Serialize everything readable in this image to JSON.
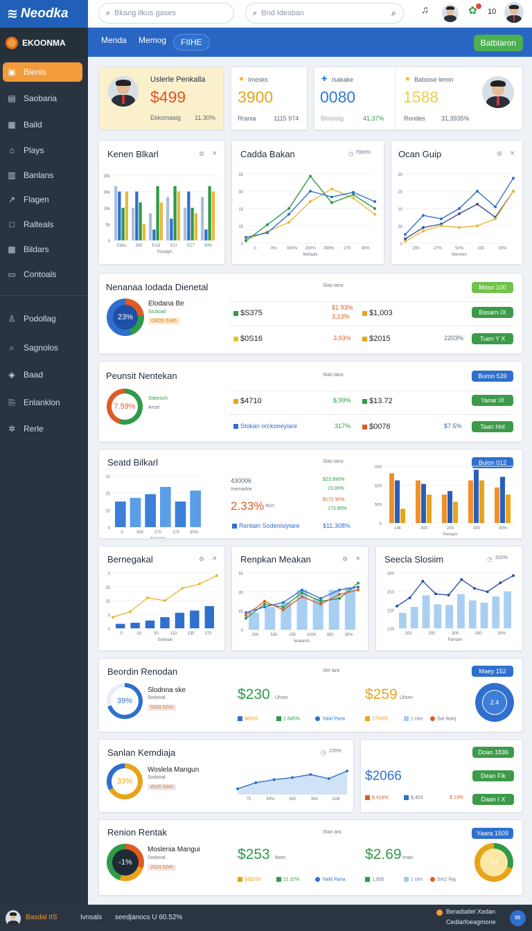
{
  "topbar": {
    "brand": "Neodka",
    "search1": "Bkang ilkus gases",
    "search2": "Bnd Idesban",
    "badge": "10"
  },
  "sidebar": {
    "brand": "EKOONMA",
    "items": [
      {
        "label": "Blenis",
        "icon": "home-icon"
      },
      {
        "label": "Saobaria",
        "icon": "doc-icon"
      },
      {
        "label": "Baild",
        "icon": "calendar-icon"
      },
      {
        "label": "Plays",
        "icon": "house-icon"
      },
      {
        "label": "Banlans",
        "icon": "briefcase-icon"
      },
      {
        "label": "Flagen",
        "icon": "chart-icon"
      },
      {
        "label": "Ralteals",
        "icon": "square-icon"
      },
      {
        "label": "Bildars",
        "icon": "grid-icon"
      },
      {
        "label": "Contoals",
        "icon": "inbox-icon"
      },
      {
        "label": "Podollag",
        "icon": "person-icon"
      },
      {
        "label": "Sagnolos",
        "icon": "search-icon"
      },
      {
        "label": "Baad",
        "icon": "shield-icon"
      },
      {
        "label": "Enlanklon",
        "icon": "link-icon"
      },
      {
        "label": "Rerle",
        "icon": "gear-icon"
      }
    ]
  },
  "nav": {
    "tabs": [
      "Menda",
      "Memog",
      "FIIHE"
    ],
    "button": "Batblaron"
  },
  "kpis": [
    {
      "title": "Uslerle Penkalla",
      "value": "$499",
      "sub_label": "Ekkomasig",
      "sub_value": "11,30%"
    },
    {
      "title": "Imesks",
      "value": "3900",
      "sub_label": "Rrania",
      "sub_value": "1115 974"
    },
    {
      "title": "Isakake",
      "value": "0080",
      "sub_label": "Binlsisig",
      "sub_value": "41,37%"
    },
    {
      "title": "Baboise lemin",
      "value": "1588",
      "sub_label": "Rondes",
      "sub_value": "31,3935%"
    }
  ],
  "row1": [
    {
      "title": "Kenen Blkarl",
      "xlabel": "Kepagls"
    },
    {
      "title": "Cadda Bakan",
      "badge": "7000%",
      "xlabel": "Mefaals"
    },
    {
      "title": "Ocan Guip",
      "xlabel": "Mannen"
    }
  ],
  "chart_data": [
    {
      "type": "bar",
      "title": "Kenen Blkarl",
      "xlabel": "Kepagls",
      "categories": [
        "Ekks",
        "300",
        "E11I",
        "E1I",
        "E17",
        "30%"
      ],
      "series": [
        {
          "values": [
            10,
            6,
            5,
            8,
            6,
            8
          ]
        },
        {
          "values": [
            9,
            9,
            2,
            4,
            9,
            2
          ]
        },
        {
          "values": [
            6,
            7,
            10,
            10,
            6,
            10
          ]
        },
        {
          "values": [
            9,
            3,
            7,
            9,
            5,
            9
          ]
        }
      ],
      "ylim": [
        0,
        12
      ],
      "yticks": [
        "30k",
        "30k",
        "19k",
        "5k",
        "0"
      ]
    },
    {
      "type": "line",
      "title": "Cadda Bakan",
      "xlabel": "Mefaals",
      "categories": [
        "0",
        "0%",
        "000%",
        "200%",
        "390%",
        "270",
        "30%"
      ],
      "series": [
        {
          "values": [
            3,
            10,
            18,
            36,
            47,
            39,
            25
          ]
        },
        {
          "values": [
            2,
            16,
            30,
            58,
            35,
            42,
            30
          ]
        },
        {
          "values": [
            5,
            9,
            25,
            45,
            40,
            44,
            36
          ]
        }
      ],
      "ylim": [
        0,
        60
      ],
      "yticks": [
        "35",
        "30",
        "15",
        "15",
        "0"
      ]
    },
    {
      "type": "line",
      "title": "Ocan Guip",
      "xlabel": "Mannen",
      "categories": [
        "200",
        "27%",
        "50%",
        "230",
        "30%"
      ],
      "series": [
        {
          "values": [
            10,
            32,
            28,
            40,
            60,
            42,
            75
          ]
        },
        {
          "values": [
            5,
            18,
            22,
            34,
            45,
            30,
            60
          ]
        },
        {
          "values": [
            2,
            14,
            20,
            18,
            20,
            28,
            60
          ]
        }
      ],
      "ylim": [
        0,
        80
      ],
      "yticks": [
        "30",
        "25",
        "10",
        "30",
        "0"
      ]
    },
    {
      "type": "bar",
      "title": "Seatd Bilkarl",
      "xlabel": "Kepanls",
      "categories": [
        "0",
        "300",
        "270",
        "270",
        "30%"
      ],
      "values": [
        7,
        8,
        9,
        11,
        7,
        10
      ],
      "ylim": [
        0,
        14
      ]
    },
    {
      "type": "bar",
      "title": "Seatd Bilkarl right",
      "xlabel": "Pentam",
      "categories": [
        "10k",
        "300",
        "200",
        "300",
        "30%"
      ],
      "series": [
        {
          "values": [
            14,
            12,
            8,
            12,
            10
          ]
        },
        {
          "values": [
            12,
            11,
            9,
            15,
            13
          ]
        },
        {
          "values": [
            4,
            8,
            6,
            12,
            8
          ]
        }
      ],
      "ylim": [
        0,
        16
      ]
    },
    {
      "type": "line",
      "title": "Bernegakal",
      "xlabel": "Sanlaali",
      "categories": [
        "0",
        "18",
        "50",
        "110",
        "135",
        "370"
      ],
      "series": [
        {
          "values": [
            20,
            30,
            55,
            50,
            72,
            80,
            95
          ]
        },
        {
          "values": [
            8,
            10,
            14,
            20,
            28,
            32,
            40
          ]
        }
      ],
      "ylim": [
        0,
        100
      ]
    },
    {
      "type": "line",
      "title": "Renpkan Meakan",
      "xlabel": "Ieaeams",
      "categories": [
        "200",
        "530",
        "250",
        "1000",
        "350",
        "30%"
      ],
      "series": [
        {
          "values": [
            20,
            45,
            40,
            65,
            50,
            55,
            82
          ]
        },
        {
          "values": [
            30,
            40,
            48,
            70,
            55,
            70,
            75
          ]
        },
        {
          "values": [
            25,
            50,
            35,
            58,
            45,
            62,
            70
          ]
        }
      ],
      "ylim": [
        0,
        100
      ]
    },
    {
      "type": "line",
      "title": "Seecla Slosiim",
      "xlabel": "Pantam",
      "categories": [
        "200",
        "200",
        "300",
        "250",
        "30%"
      ],
      "series": [
        {
          "values": [
            40,
            55,
            85,
            62,
            60,
            88,
            72,
            66,
            82,
            95
          ]
        }
      ],
      "ylim": [
        0,
        100
      ]
    },
    {
      "type": "area",
      "title": "Sanlan Kemdiaja",
      "categories": [
        "75",
        "40%",
        "360",
        "304",
        "3AB"
      ],
      "values": [
        10,
        22,
        28,
        32,
        38,
        30,
        45
      ],
      "ylim": [
        0,
        60
      ]
    }
  ],
  "list1": {
    "title": "Nenanaa Iodada Dienetal",
    "caption": "Stan tans",
    "tag": "Mosn 100",
    "donut_pct": "23%",
    "donut_title": "Elodana Be",
    "donut_sub": "Sicdoad",
    "donut_chip": "GIIOS 5345",
    "rows": [
      {
        "a": "$S375",
        "p1": "$1.93%",
        "p2": "3,13%",
        "b": "$1,003",
        "btn": "Basarn IX"
      },
      {
        "a": "$0S16",
        "p1": "3,93%",
        "b": "$2015",
        "p3": "2203%",
        "btn": "Tuen Y X"
      }
    ]
  },
  "list2": {
    "title": "Peunsit Nentekan",
    "caption": "Stan tans",
    "tag": "Buron 539",
    "donut_pct": "7.59%",
    "donut_title": "Stdoroch",
    "donut_sub": "Arcel",
    "rows": [
      {
        "a": "$4710",
        "p1": "$,99%",
        "b": "$13.72",
        "btn": "Yanar IX"
      },
      {
        "a": "Stokan orckoneyiare",
        "p1": "317%",
        "b": "$0076",
        "p3": "$7 5%",
        "btn": "Taan Hol"
      }
    ]
  },
  "list3": {
    "title": "Seatd Bilkarl",
    "caption": "Stan tans",
    "tag": "Bulon 012",
    "metric1": "430006",
    "metric2": "Inemarkie",
    "pct": "2.33%",
    "pct_unit": "Iticn",
    "stats": [
      "$23.990%",
      "23.06%",
      "$172 90%",
      "173.90%"
    ],
    "legend": "Rentain Sodenisiyiare",
    "legend_val": "$11.308%"
  },
  "row3": [
    {
      "title": "Bernegakal"
    },
    {
      "title": "Renpkan Meakan"
    },
    {
      "title": "Seecla Slosiim",
      "badge": "320%"
    }
  ],
  "list4": {
    "title": "Beordin Renodan",
    "caption": "Stri tant",
    "tag": "Maey 152",
    "donut_pct": "39%",
    "donut_title": "Slodnna ske",
    "donut_sub": "Sodonal",
    "donut_chip": "5334 5243",
    "m1": "$230",
    "m1u": "Uhom",
    "m2": "$259",
    "m2u": "Uhom",
    "donut2": "2.4",
    "legend": [
      "$6005",
      "1.645%",
      "Yalal Pane",
      "275085",
      "1 nim",
      "Sat Ikanj"
    ]
  },
  "list5": {
    "title": "Sanlan Kemdiaja",
    "badge": "220%",
    "donut_pct": "33%",
    "donut_title": "Woslela Mangun",
    "donut_sub": "Sodonal",
    "donut_chip": "4535 3345",
    "val": "$2066",
    "r1": "$.419%",
    "r2": "$,403",
    "r3": "$.13%",
    "btns": [
      "Doan 1836",
      "Dean Fik",
      "Daan I X"
    ]
  },
  "list6": {
    "title": "Renion Rentak",
    "caption": "Stan anc",
    "tag": "Yaara 1509",
    "donut_pct": "-1%",
    "donut_title": "Moslenia Mangui",
    "donut_sub": "Sodonal",
    "donut_chip": "2524 5245",
    "m1": "$253",
    "m1u": "Ibom",
    "m2": "$2.69",
    "m2u": "Iman",
    "donut2": "2.4",
    "legend": [
      "$4$209",
      "11.32%",
      "Yaild Pana",
      "1,905",
      "1 nim",
      "Sm2 Raj"
    ]
  },
  "footer": {
    "user": "Basdal IIS",
    "col2": "Ivnsals",
    "col3": "seedjanocs U 60.52%",
    "right1": "Beradiatlel Xedan",
    "right2": "Cedlarfoeagmone"
  }
}
